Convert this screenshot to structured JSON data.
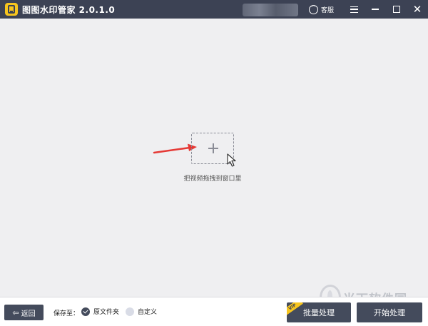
{
  "window": {
    "title": "图图水印管家  2.0.1.0",
    "service_label": "客服"
  },
  "main": {
    "drop_hint": "把视频拖拽到窗口里"
  },
  "footer": {
    "back_label": "返回",
    "save_to_label": "保存至：",
    "options": [
      {
        "label": "原文件夹",
        "checked": true
      },
      {
        "label": "自定义",
        "checked": false
      }
    ],
    "batch_label": "批量处理",
    "vip_badge": "VIP",
    "start_label": "开始处理"
  },
  "watermark": {
    "text": "当下软件园"
  },
  "colors": {
    "titlebar": "#3c4254",
    "accent": "#f7c51e",
    "button": "#444b5c",
    "arrow": "#e53935",
    "background": "#efeff1"
  },
  "icons": {
    "logo": "app-logo-icon",
    "service": "chat-bubble-icon",
    "menu": "hamburger-menu-icon",
    "minimize": "minimize-icon",
    "maximize": "maximize-icon",
    "close": "close-icon",
    "add": "plus-icon",
    "back": "back-arrow-icon"
  }
}
